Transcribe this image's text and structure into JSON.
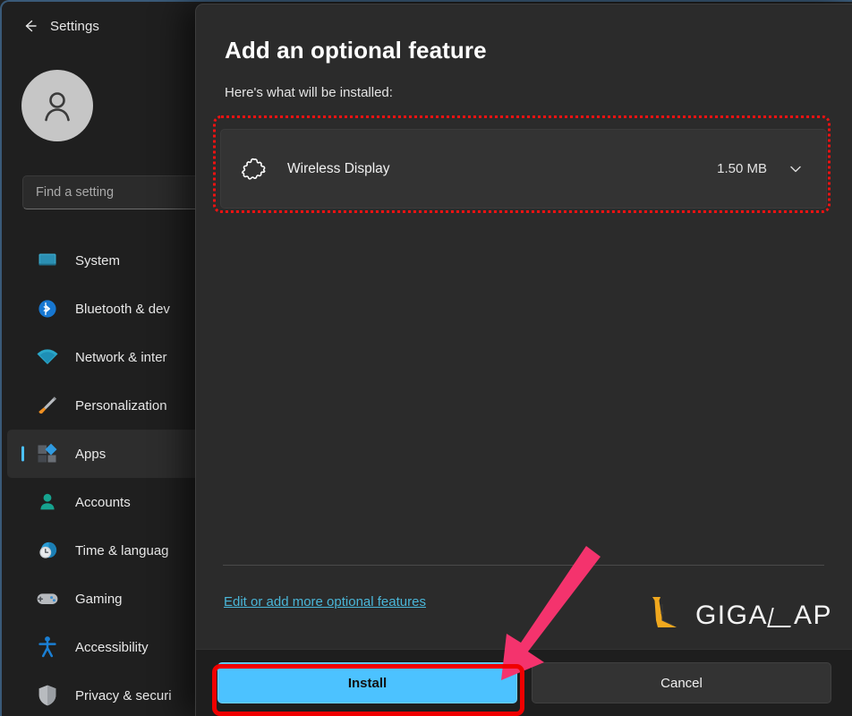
{
  "window": {
    "app_title": "Settings",
    "back_icon": "back-arrow-icon",
    "accent_color": "#4cc2ff"
  },
  "sidebar": {
    "avatar_icon": "person-avatar-icon",
    "search": {
      "placeholder": "Find a setting",
      "value": "",
      "icon": "search-icon"
    },
    "items": [
      {
        "label": "System",
        "icon": "monitor-icon",
        "active": false
      },
      {
        "label": "Bluetooth & dev",
        "icon": "bluetooth-icon",
        "active": false
      },
      {
        "label": "Network & inter",
        "icon": "wifi-icon",
        "active": false
      },
      {
        "label": "Personalization",
        "icon": "paintbrush-icon",
        "active": false
      },
      {
        "label": "Apps",
        "icon": "apps-icon",
        "active": true
      },
      {
        "label": "Accounts",
        "icon": "person-icon",
        "active": false
      },
      {
        "label": "Time & languag",
        "icon": "clock-globe-icon",
        "active": false
      },
      {
        "label": "Gaming",
        "icon": "gamepad-icon",
        "active": false
      },
      {
        "label": "Accessibility",
        "icon": "accessibility-icon",
        "active": false
      },
      {
        "label": "Privacy & securi",
        "icon": "shield-icon",
        "active": false
      }
    ]
  },
  "dialog": {
    "title": "Add an optional feature",
    "subtitle": "Here's what will be installed:",
    "feature": {
      "name": "Wireless Display",
      "size": "1.50 MB",
      "icon": "puzzle-feature-icon",
      "expand_icon": "chevron-down-icon"
    },
    "edit_link": "Edit or add more optional features",
    "buttons": {
      "install": "Install",
      "cancel": "Cancel"
    }
  },
  "logo": {
    "text_a": "GIGA",
    "text_b": "AP",
    "mark_icon": "gigalap-laptop-mark-icon",
    "mark_color": "#f0a81e"
  },
  "annotations": {
    "feature_highlight_color": "#ef1212",
    "install_highlight_color": "#f00000",
    "arrow_color": "#f4336d"
  }
}
